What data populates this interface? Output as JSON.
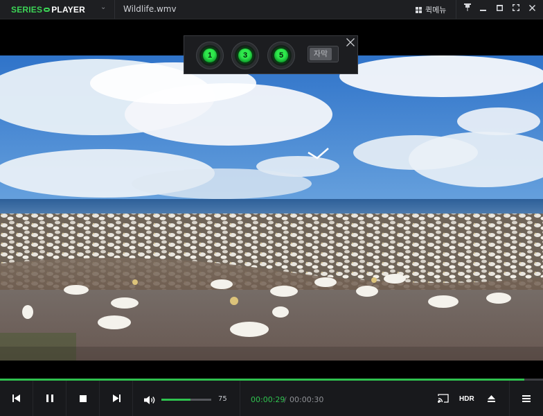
{
  "app": {
    "logo_series": "SERIES",
    "logo_player": "PLAYER",
    "filename": "Wildlife.wmv"
  },
  "titlebar": {
    "quick_menu": "퀵메뉴",
    "icons": [
      "grid-icon",
      "pin-icon",
      "minimize-icon",
      "maximize-icon",
      "fullscreen-icon",
      "close-icon"
    ]
  },
  "skip_panel": {
    "buttons": [
      "1",
      "3",
      "5"
    ],
    "subtitle_label": "자막"
  },
  "playback": {
    "progress_fraction": 0.966,
    "volume": "75",
    "volume_fraction": 0.58,
    "current_time": "00:00:29",
    "separator": "/",
    "total_time": "00:00:30",
    "hdr_label": "HDR"
  },
  "colors": {
    "accent": "#2fc24f",
    "background": "#18191c"
  }
}
